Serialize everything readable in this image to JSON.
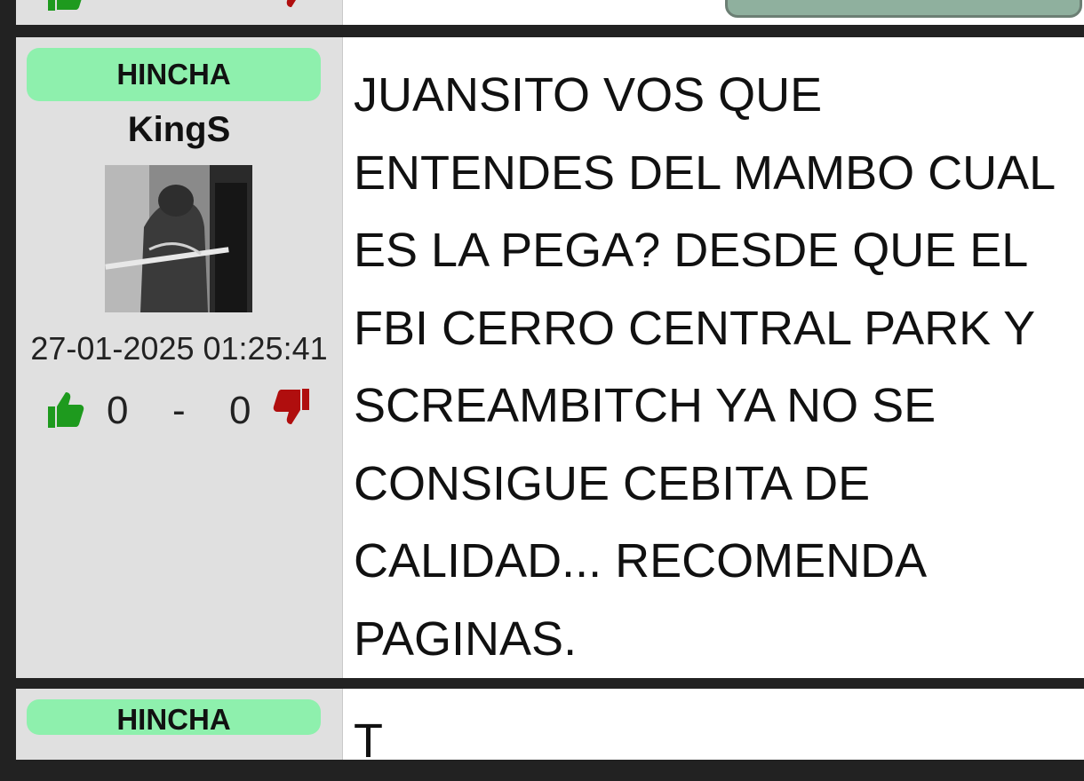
{
  "posts": {
    "main": {
      "rank": "HINCHA",
      "username": "KingS",
      "avatar_alt": "",
      "timestamp": "27-01-2025 01:25:41",
      "upvotes": "0",
      "separator": "-",
      "downvotes": "0",
      "text": "JUANSITO VOS QUE ENTENDES DEL MAMBO CUAL ES LA PEGA? DESDE QUE EL FBI CERRO CENTRAL PARK Y SCREAMBITCH YA NO SE CONSIGUE CEBITA DE CALIDAD... RECOMENDA PAGINAS."
    },
    "next": {
      "rank": "HINCHA",
      "text": "T"
    }
  },
  "icons": {
    "upvote": "thumbs-up-icon",
    "downvote": "thumbs-down-icon"
  },
  "colors": {
    "page_bg": "#222222",
    "sidebar_bg": "#e0e0e0",
    "rank_badge": "#8ef0ad",
    "upvote": "#1e9a1e",
    "downvote": "#b00e0e",
    "reply_button": "#8fb09e"
  }
}
